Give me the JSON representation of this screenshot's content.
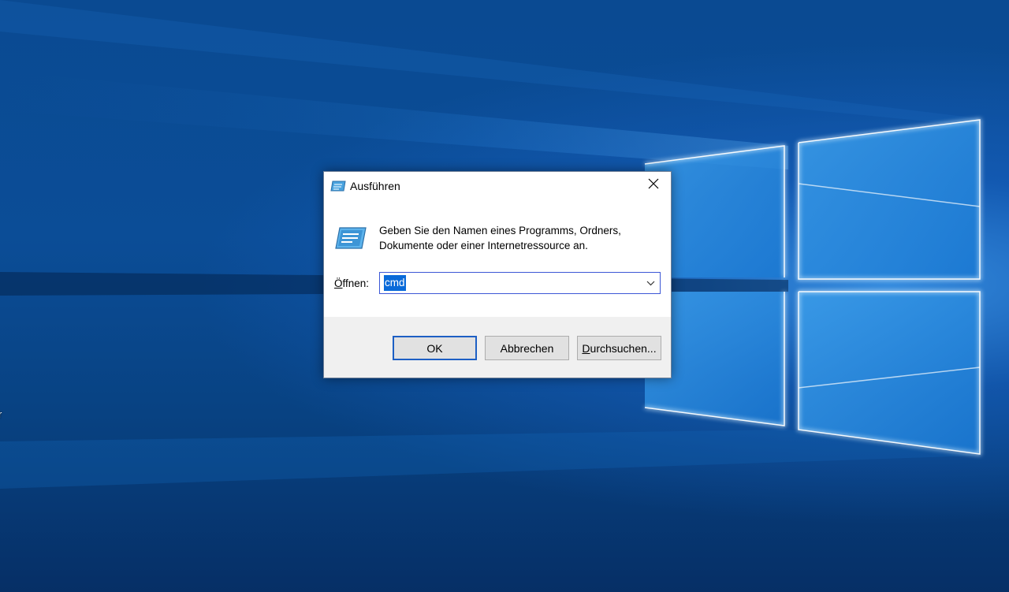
{
  "desktop": {
    "edge_label": "r"
  },
  "dialog": {
    "title": "Ausführen",
    "close_icon": "close-icon",
    "run_icon": "run-program-icon",
    "description_line1": "Geben Sie den Namen eines Programms, Ordners,",
    "description_line2": "Dokumente oder einer Internetressource an.",
    "open_label_prefix": "Ö",
    "open_label_rest": "ffnen:",
    "open_value": "cmd",
    "ok_label": "OK",
    "cancel_label": "Abbrechen",
    "browse_label_prefix": "D",
    "browse_label_rest": "urchsuchen..."
  },
  "colors": {
    "desktop_blue": "#0a4a92",
    "selection_blue": "#0a6ad9",
    "focus_border": "#3c57d6",
    "footer_gray": "#f0f0f0"
  }
}
